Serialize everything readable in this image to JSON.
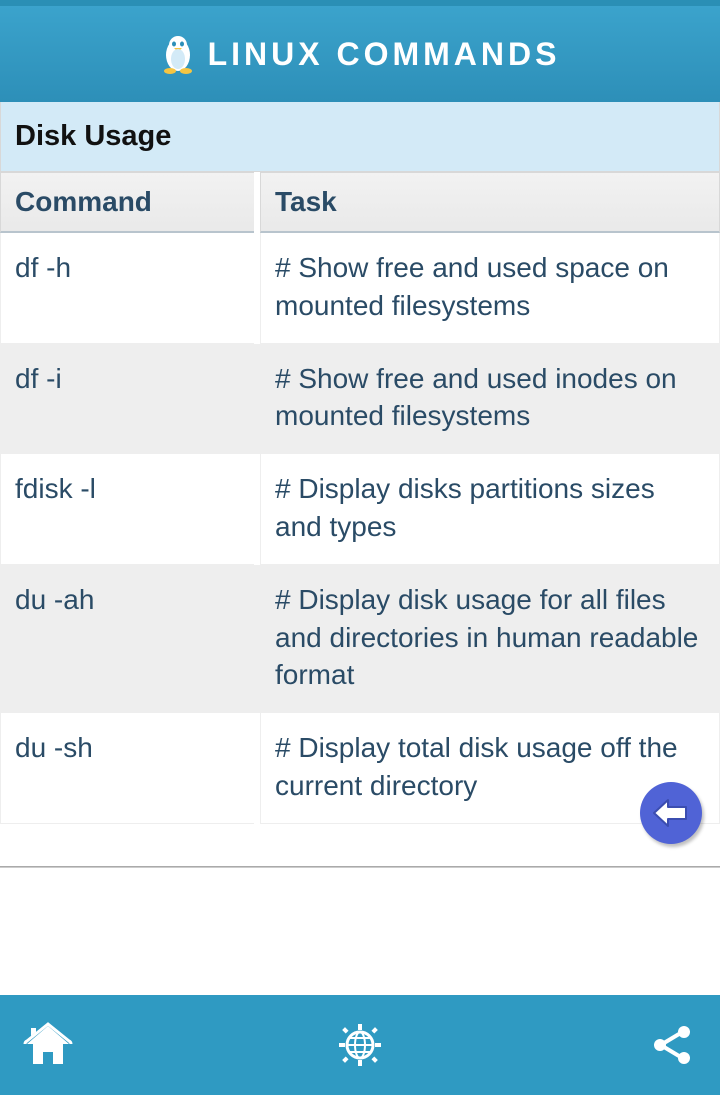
{
  "header": {
    "title": "LINUX COMMANDS"
  },
  "section": {
    "title": "Disk Usage"
  },
  "columns": {
    "command": "Command",
    "task": "Task"
  },
  "rows": [
    {
      "command": "df -h",
      "task": "# Show free and used space on mounted filesystems"
    },
    {
      "command": "df -i",
      "task": "# Show free and used inodes on mounted filesystems"
    },
    {
      "command": "fdisk -l",
      "task": "# Display disks partitions sizes and types"
    },
    {
      "command": "du -ah",
      "task": "# Display disk usage for all files and directories in human readable format"
    },
    {
      "command": "du -sh",
      "task": "# Display total disk usage off the current directory"
    }
  ]
}
